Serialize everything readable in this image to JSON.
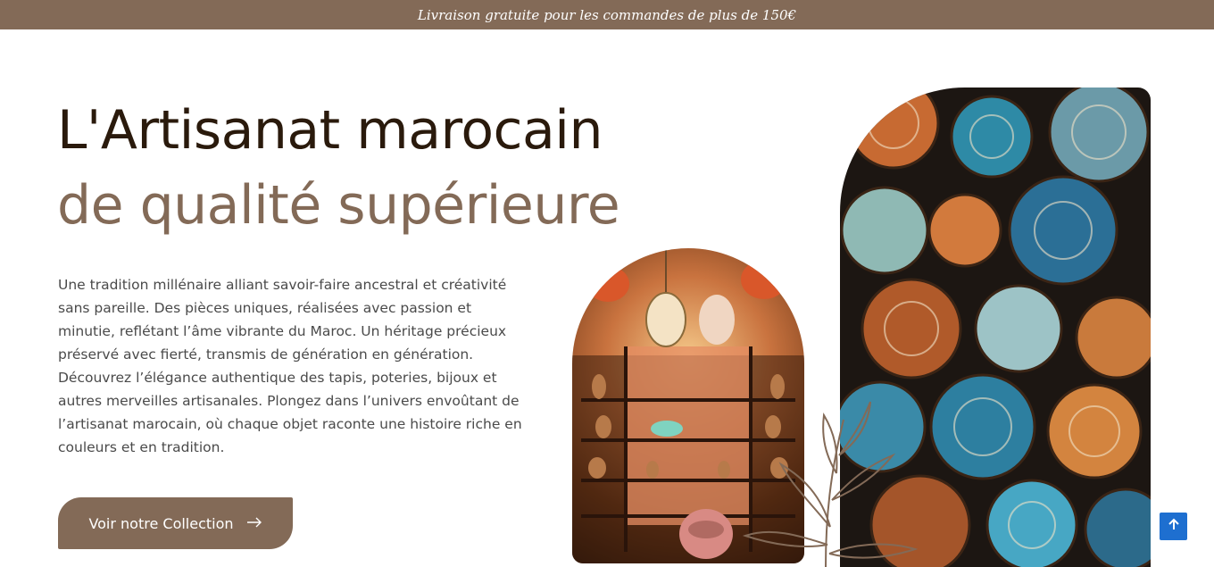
{
  "topbar": {
    "text": "Livraison gratuite pour les commandes de plus de 150€"
  },
  "hero": {
    "title_line1": "L'Artisanat marocain",
    "title_line2": "de qualité supérieure",
    "description": "Une tradition millénaire alliant savoir-faire ancestral et créativité sans pareille. Des pièces uniques, réalisées avec passion et minutie, reflétant l’âme vibrante du Maroc. Un héritage précieux préservé avec fierté, transmis de génération en génération. Découvrez l’élégance authentique des tapis, poteries, bijoux et autres merveilles artisanales. Plongez dans l’univers envoûtant de l’artisanat marocain, où chaque objet raconte une histoire riche en couleurs et en tradition.",
    "cta_label": "Voir notre Collection",
    "cta_icon": "arrow-right-icon"
  },
  "images": {
    "shop_icon": "lantern-shop-image",
    "bowls_icon": "ceramic-bowls-image",
    "deco_icon": "leaf-branch-icon"
  },
  "scroll_top": {
    "icon": "chevron-up-icon"
  },
  "colors": {
    "brand": "#836a57",
    "title_dark": "#2a1a0c",
    "body_text": "#4a4a4a",
    "scroll_button": "#1e6fd0"
  }
}
